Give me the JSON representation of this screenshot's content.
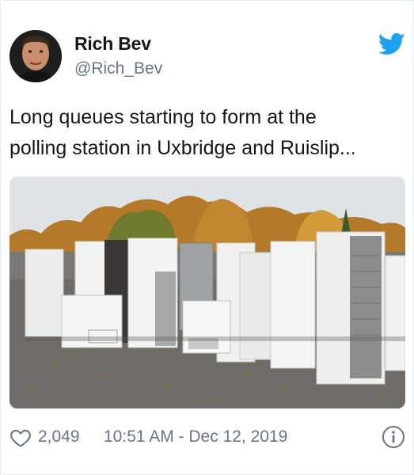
{
  "tweet": {
    "author_name": "Rich Bev",
    "author_handle": "@Rich_Bev",
    "text": "Long queues starting to form at the\npolling station in Uxbridge and Ruislip...",
    "likes": "2,049",
    "timestamp": "10:51 AM - Dec 12, 2019"
  },
  "icons": {
    "logo": "twitter-bird-icon",
    "like": "heart-icon",
    "info": "info-icon"
  },
  "colors": {
    "brand": "#1da1f2",
    "secondary_text": "#657786",
    "primary_text": "#14171a",
    "border": "#e6ecf0"
  }
}
